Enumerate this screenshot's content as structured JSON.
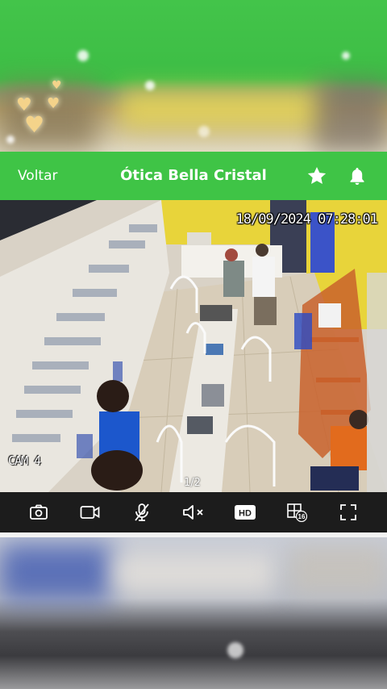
{
  "header": {
    "back_label": "Voltar",
    "title": "Ótica Bella Cristal",
    "favorite_icon": "star-icon",
    "notification_icon": "bell-icon"
  },
  "video": {
    "timestamp": "18/09/2024 07:28:01",
    "camera_label": "CAM 4",
    "pager": "1/2"
  },
  "controls": [
    {
      "name": "snapshot-button",
      "icon": "camera-icon"
    },
    {
      "name": "record-button",
      "icon": "video-camera-icon"
    },
    {
      "name": "microphone-button",
      "icon": "microphone-muted-icon"
    },
    {
      "name": "audio-button",
      "icon": "speaker-muted-icon"
    },
    {
      "name": "quality-button",
      "icon": "hd-icon",
      "label": "HD"
    },
    {
      "name": "multi-view-button",
      "icon": "grid-16-icon",
      "label": "16"
    },
    {
      "name": "fullscreen-button",
      "icon": "fullscreen-icon"
    }
  ],
  "colors": {
    "header_green": "#3fc446",
    "control_bar": "#1c1c1c",
    "icon_white": "#ffffff"
  }
}
